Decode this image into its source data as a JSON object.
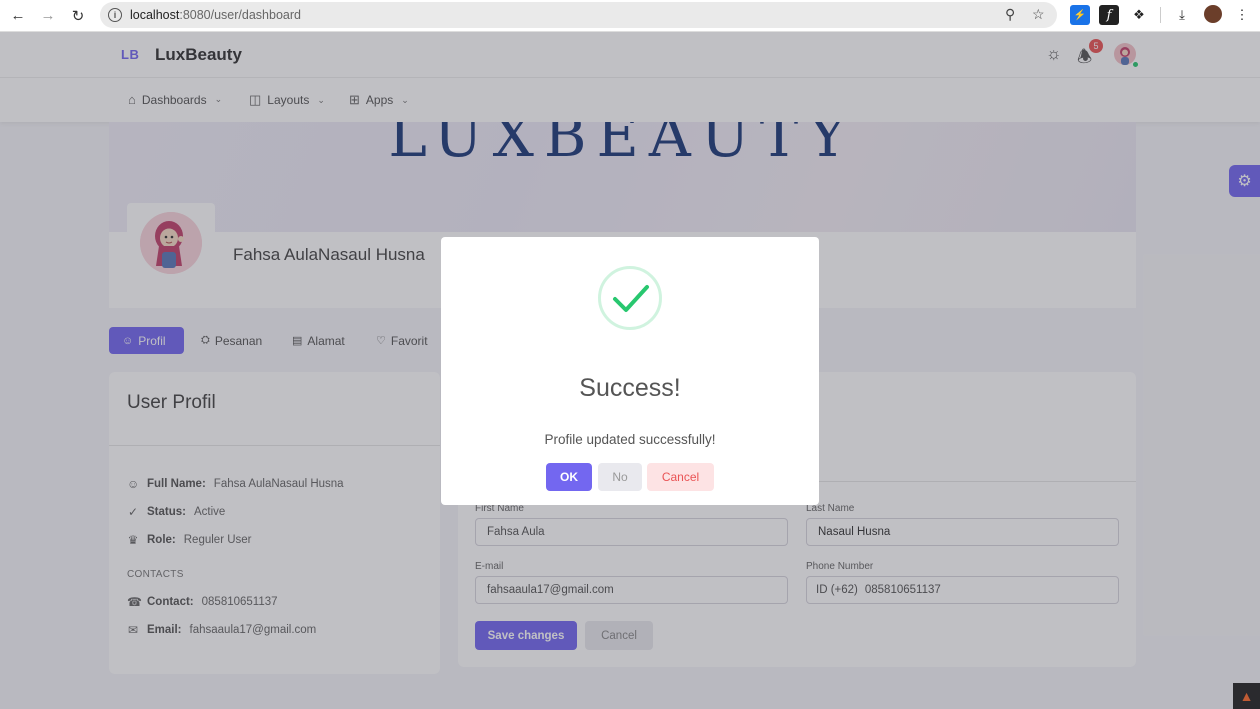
{
  "browser": {
    "url_host": "localhost",
    "url_rest": ":8080/user/dashboard",
    "badge_ext": "⚡"
  },
  "header": {
    "logo_mark": "LB",
    "app_name": "LuxBeauty",
    "notification_count": "5"
  },
  "menu": {
    "items": [
      {
        "label": "Dashboards",
        "icon": "home-icon"
      },
      {
        "label": "Layouts",
        "icon": "layout-icon"
      },
      {
        "label": "Apps",
        "icon": "apps-grid-icon"
      }
    ]
  },
  "banner": {
    "text": "LUXBEAUTY"
  },
  "profile": {
    "name": "Fahsa AulaNasaul Husna"
  },
  "tabs": [
    {
      "label": "Profil",
      "active": true
    },
    {
      "label": "Pesanan",
      "active": false
    },
    {
      "label": "Alamat",
      "active": false
    },
    {
      "label": "Favorit",
      "active": false
    }
  ],
  "user_card": {
    "title": "User Profil",
    "full_name_label": "Full Name:",
    "full_name": "Fahsa AulaNasaul Husna",
    "status_label": "Status:",
    "status": "Active",
    "role_label": "Role:",
    "role": "Reguler User",
    "contacts_header": "CONTACTS",
    "contact_label": "Contact:",
    "contact": "085810651137",
    "email_label": "Email:",
    "email": "fahsaaula17@gmail.com"
  },
  "form": {
    "first_name_label": "First Name",
    "first_name": "Fahsa Aula",
    "last_name_label": "Last Name",
    "last_name": "Nasaul Husna",
    "email_label": "E-mail",
    "email": "fahsaaula17@gmail.com",
    "phone_label": "Phone Number",
    "phone_prefix": "ID (+62)",
    "phone": "085810651137",
    "save_label": "Save changes",
    "cancel_label": "Cancel"
  },
  "modal": {
    "title": "Success!",
    "message": "Profile updated successfully!",
    "ok_label": "OK",
    "no_label": "No",
    "cancel_label": "Cancel"
  },
  "colors": {
    "primary": "#7367f0",
    "success": "#28c76f",
    "danger": "#ea5455"
  }
}
